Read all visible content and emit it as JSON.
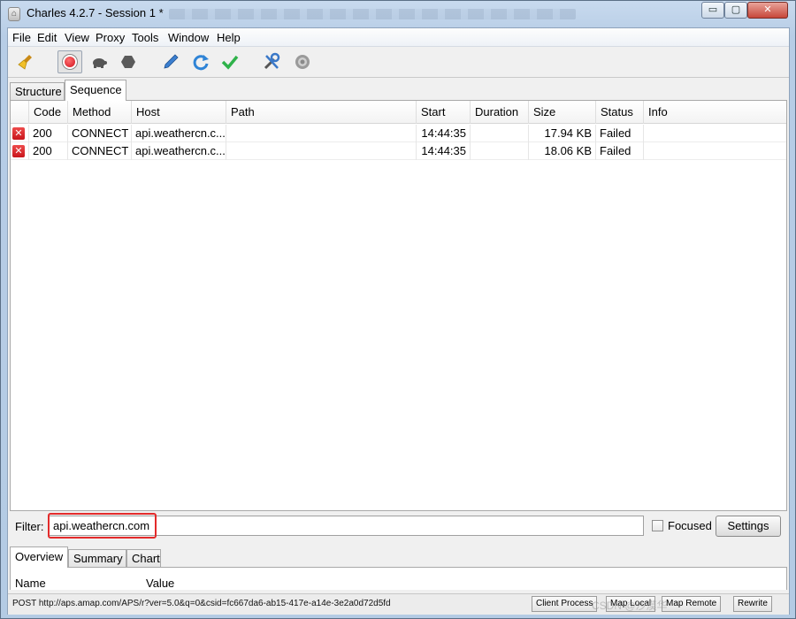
{
  "window": {
    "title": "Charles 4.2.7 - Session 1 *",
    "controls": {
      "minimize": "▭",
      "maximize": "▢",
      "close": "✕"
    }
  },
  "menu": [
    "File",
    "Edit",
    "View",
    "Proxy",
    "Tools",
    "Window",
    "Help"
  ],
  "toolbar": [
    "broom-icon",
    "record-icon",
    "throttle-turtle-icon",
    "breakpoint-hexagon-icon",
    "compose-pen-icon",
    "repeat-refresh-icon",
    "validate-check-icon",
    "tools-icon",
    "settings-gear-icon"
  ],
  "view_tabs": {
    "structure": "Structure",
    "sequence": "Sequence"
  },
  "table": {
    "columns": [
      "Code",
      "Method",
      "Host",
      "Path",
      "Start",
      "Duration",
      "Size",
      "Status",
      "Info"
    ],
    "rows": [
      {
        "status_icon": "error-x-icon",
        "code": "200",
        "method": "CONNECT",
        "host": "api.weathercn.c...",
        "path": "",
        "start": "14:44:35",
        "duration": "",
        "size": "17.94 KB",
        "status": "Failed",
        "info": ""
      },
      {
        "status_icon": "error-x-icon",
        "code": "200",
        "method": "CONNECT",
        "host": "api.weathercn.c...",
        "path": "",
        "start": "14:44:35",
        "duration": "",
        "size": "18.06 KB",
        "status": "Failed",
        "info": ""
      }
    ]
  },
  "filter": {
    "label": "Filter:",
    "value": "api.weathercn.com",
    "focused_label": "Focused",
    "settings_label": "Settings"
  },
  "detail_tabs": {
    "overview": "Overview",
    "summary": "Summary",
    "chart": "Chart"
  },
  "detail_columns": {
    "name": "Name",
    "value": "Value"
  },
  "status": {
    "text": "POST http://aps.amap.com/APS/r?ver=5.0&q=0&csid=fc667da6-ab15-417e-a14e-3e2a0d72d5fd",
    "buttons": {
      "client_process": "Client Process",
      "map_local": "Map Local",
      "map_remote": "Map Remote",
      "rewrite": "Rewrite"
    },
    "watermark": "CSDN @沙漠华"
  },
  "colors": {
    "error": "#d0101b",
    "highlight": "#e32b2b",
    "titlebar": "#c8daee"
  }
}
